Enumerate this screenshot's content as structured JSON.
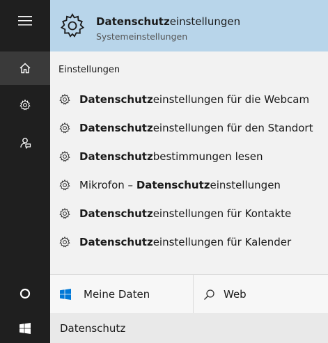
{
  "best_match": {
    "title_bold": "Datenschutz",
    "title_rest": "einstellungen",
    "subtitle": "Systemeinstellungen",
    "icon": "gear-icon"
  },
  "section": {
    "header": "Einstellungen"
  },
  "results": [
    {
      "pre": "",
      "bold": "Datenschutz",
      "post": "einstellungen für die Webcam",
      "icon": "gear-icon"
    },
    {
      "pre": "",
      "bold": "Datenschutz",
      "post": "einstellungen für den Standort",
      "icon": "gear-icon"
    },
    {
      "pre": "",
      "bold": "Datenschutz",
      "post": "bestimmungen lesen",
      "icon": "gear-icon"
    },
    {
      "pre": "Mikrofon – ",
      "bold": "Datenschutz",
      "post": "einstellungen",
      "icon": "gear-icon"
    },
    {
      "pre": "",
      "bold": "Datenschutz",
      "post": "einstellungen für Kontakte",
      "icon": "gear-icon"
    },
    {
      "pre": "",
      "bold": "Datenschutz",
      "post": "einstellungen für Kalender",
      "icon": "gear-icon"
    }
  ],
  "tabs": {
    "my_stuff": {
      "label": "Meine Daten",
      "icon": "windows-logo-icon"
    },
    "web": {
      "label": "Web",
      "icon": "search-icon"
    }
  },
  "search": {
    "query": "Datenschutz"
  },
  "rail": {
    "items": [
      "hamburger-menu-icon",
      "home-icon",
      "gear-icon",
      "feedback-icon",
      "cortana-circle-icon",
      "windows-logo-icon"
    ],
    "active": "home-icon"
  },
  "colors": {
    "rail_bg": "#1f1f1f",
    "highlight_bg": "#b8d5ea",
    "panel_bg": "#f2f2f2"
  }
}
